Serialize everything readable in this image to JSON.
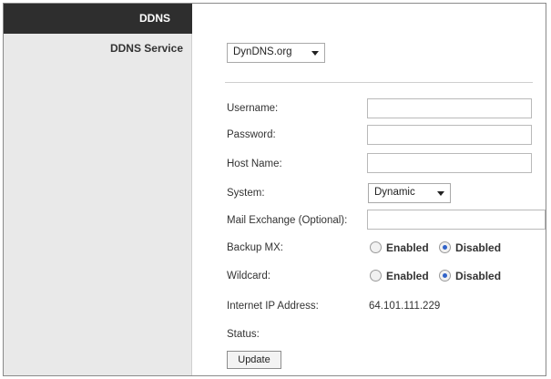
{
  "sidebar": {
    "header": "DDNS",
    "section_label": "DDNS Service"
  },
  "service_select": {
    "value": "DynDNS.org"
  },
  "fields": {
    "username": {
      "label": "Username:",
      "value": ""
    },
    "password": {
      "label": "Password:",
      "value": ""
    },
    "host_name": {
      "label": "Host Name:",
      "value": ""
    },
    "system": {
      "label": "System:",
      "value": "Dynamic"
    },
    "mail_exchange": {
      "label": "Mail Exchange (Optional):",
      "value": ""
    },
    "backup_mx": {
      "label": "Backup MX:",
      "options": [
        "Enabled",
        "Disabled"
      ],
      "selected": "Disabled"
    },
    "wildcard": {
      "label": "Wildcard:",
      "options": [
        "Enabled",
        "Disabled"
      ],
      "selected": "Disabled"
    },
    "internet_ip": {
      "label": "Internet IP Address:",
      "value": "64.101.111.229"
    },
    "status": {
      "label": "Status:",
      "value": ""
    }
  },
  "actions": {
    "update_label": "Update"
  },
  "colors": {
    "sidebar_header": "#2e2e2e",
    "sidebar_bg": "#e9e9e9",
    "radio_selected": "#2f62c9"
  }
}
